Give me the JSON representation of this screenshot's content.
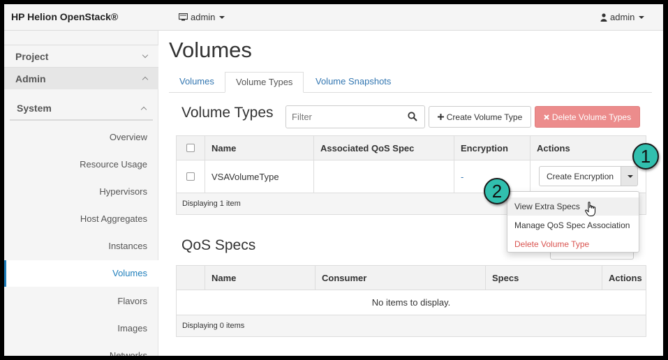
{
  "navbar": {
    "brand": "HP Helion OpenStack®",
    "project_menu": "admin",
    "user_menu": "admin"
  },
  "sidebar": {
    "groups": [
      {
        "label": "Project"
      },
      {
        "label": "Admin"
      },
      {
        "label": "System"
      }
    ],
    "items": [
      {
        "label": "Overview"
      },
      {
        "label": "Resource Usage"
      },
      {
        "label": "Hypervisors"
      },
      {
        "label": "Host Aggregates"
      },
      {
        "label": "Instances"
      },
      {
        "label": "Volumes"
      },
      {
        "label": "Flavors"
      },
      {
        "label": "Images"
      },
      {
        "label": "Networks"
      }
    ],
    "active_item": "Volumes"
  },
  "page": {
    "title": "Volumes",
    "tabs": [
      {
        "label": "Volumes"
      },
      {
        "label": "Volume Types"
      },
      {
        "label": "Volume Snapshots"
      }
    ],
    "active_tab": "Volume Types"
  },
  "volume_types": {
    "title": "Volume Types",
    "filter_placeholder": "Filter",
    "create_button": "Create Volume Type",
    "delete_button": "Delete Volume Types",
    "columns": [
      "Name",
      "Associated QoS Spec",
      "Encryption",
      "Actions"
    ],
    "rows": [
      {
        "name": "VSAVolumeType",
        "qos": "",
        "encryption": "-",
        "action": "Create Encryption"
      }
    ],
    "footer": "Displaying 1 item"
  },
  "action_menu": {
    "items": [
      {
        "label": "View Extra Specs"
      },
      {
        "label": "Manage QoS Spec Association"
      },
      {
        "label": "Delete Volume Type"
      }
    ]
  },
  "qos_specs": {
    "title": "QoS Specs",
    "columns": [
      "Name",
      "Consumer",
      "Specs",
      "Actions"
    ],
    "empty_message": "No items to display.",
    "footer": "Displaying 0 items"
  },
  "annotations": {
    "step1": "1",
    "step2": "2"
  },
  "colors": {
    "link": "#3276b1",
    "active_sidebar": "#1e7ebb",
    "danger_button": "#ec8c8c",
    "danger_text": "#d9534f",
    "badge": "#31bfae"
  }
}
